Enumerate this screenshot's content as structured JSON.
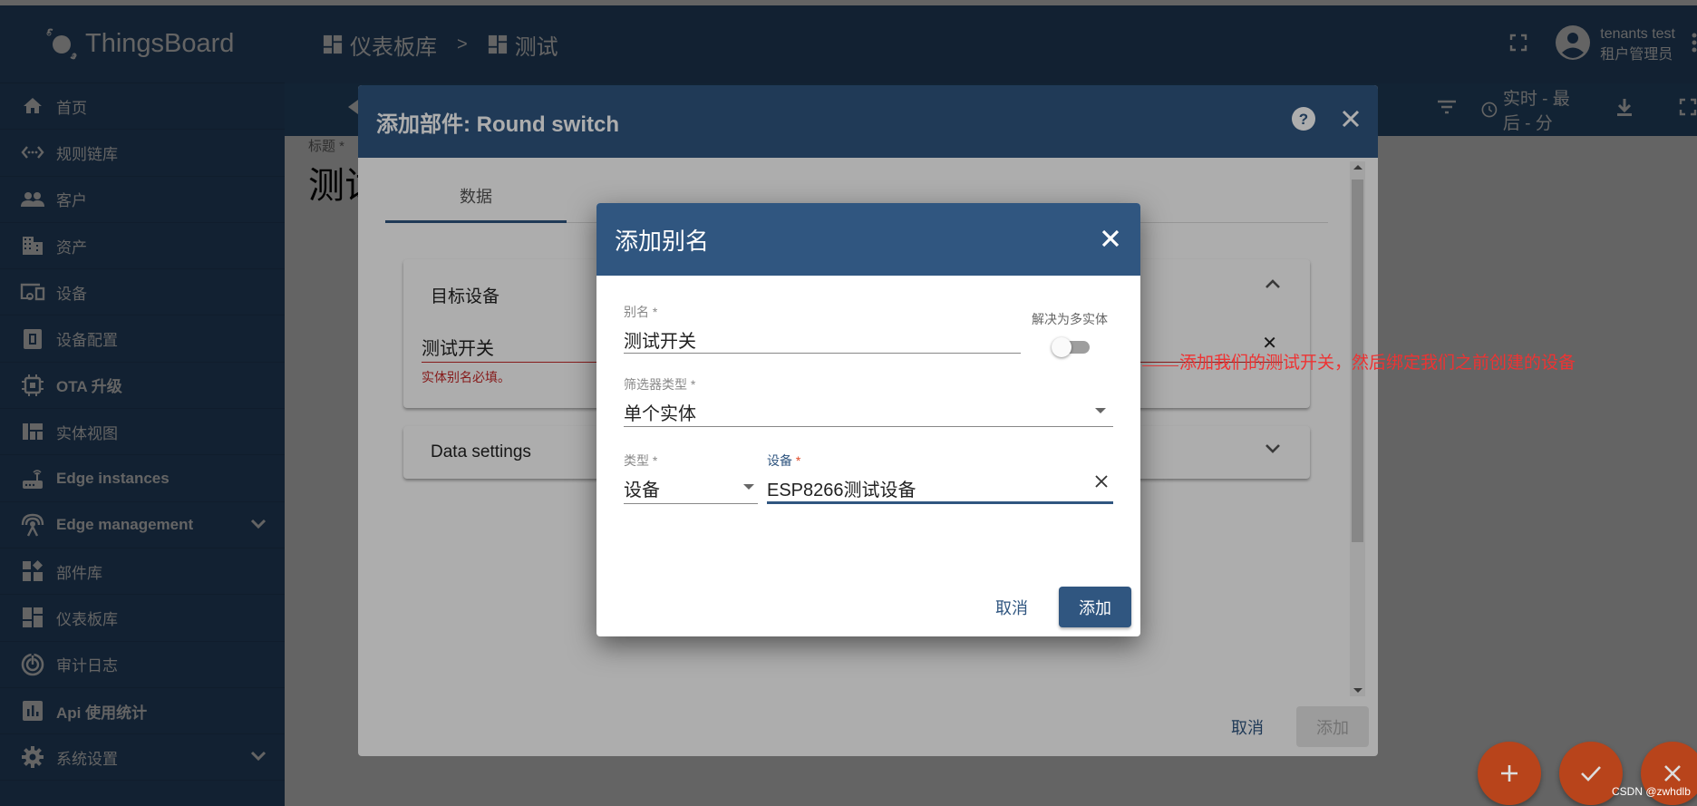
{
  "app": {
    "logo_text": "ThingsBoard"
  },
  "sidebar": {
    "items": [
      {
        "label": "首页",
        "icon": "home-icon"
      },
      {
        "label": "规则链库",
        "icon": "code-icon"
      },
      {
        "label": "客户",
        "icon": "people-icon"
      },
      {
        "label": "资产",
        "icon": "domain-icon"
      },
      {
        "label": "设备",
        "icon": "devices-icon"
      },
      {
        "label": "设备配置",
        "icon": "device-profile-icon"
      },
      {
        "label": "OTA 升级",
        "icon": "chip-icon"
      },
      {
        "label": "实体视图",
        "icon": "view-quilt-icon"
      },
      {
        "label": "Edge instances",
        "icon": "router-icon"
      },
      {
        "label": "Edge management",
        "icon": "antenna-icon",
        "expandable": true
      },
      {
        "label": "部件库",
        "icon": "widgets-icon"
      },
      {
        "label": "仪表板库",
        "icon": "dashboard-icon"
      },
      {
        "label": "审计日志",
        "icon": "track-changes-icon"
      },
      {
        "label": "Api 使用统计",
        "icon": "insert-chart-icon"
      },
      {
        "label": "系统设置",
        "icon": "settings-icon",
        "expandable": true
      }
    ]
  },
  "header": {
    "breadcrumb": [
      {
        "label": "仪表板库",
        "icon": "dashboard-icon"
      },
      {
        "label": "测试",
        "icon": "dashboard-icon"
      }
    ],
    "breadcrumb_separator": ">",
    "user_name": "tenants test",
    "user_role": "租户管理员"
  },
  "toolbar": {
    "timewindow_label": "实时 - 最后 - 分"
  },
  "dashboard": {
    "title_label": "标题 *",
    "title_value": "测试"
  },
  "widget_dialog": {
    "title": "添加部件: Round switch",
    "tabs": [
      {
        "label": "数据",
        "active": true
      }
    ],
    "target_panel": {
      "title": "目标设备",
      "alias_value": "测试开关",
      "error": "实体别名必填。",
      "expanded": true
    },
    "data_settings_panel": {
      "title": "Data settings",
      "expanded": false
    },
    "cancel_label": "取消",
    "add_label": "添加"
  },
  "alias_dialog": {
    "title": "添加别名",
    "alias_label": "别名 *",
    "alias_value": "测试开关",
    "resolve_multiple_label": "解决为多实体",
    "resolve_multiple_on": false,
    "filter_type_label": "筛选器类型 *",
    "filter_type_value": "单个实体",
    "type_label": "类型 *",
    "type_value": "设备",
    "device_label": "设备",
    "device_required_mark": "*",
    "device_value": "ESP8266测试设备",
    "cancel_label": "取消",
    "add_label": "添加"
  },
  "annotation": {
    "text": "添加我们的测试开关，然后绑定我们之前创建的设备",
    "color": "#ee3333"
  },
  "fabs": {
    "add": "add-icon",
    "apply": "check-icon",
    "close": "close-icon"
  },
  "watermark": "CSDN @zwhdlb",
  "colors": {
    "primary": "#305680",
    "fab": "#b8441b",
    "error": "#c62828"
  }
}
